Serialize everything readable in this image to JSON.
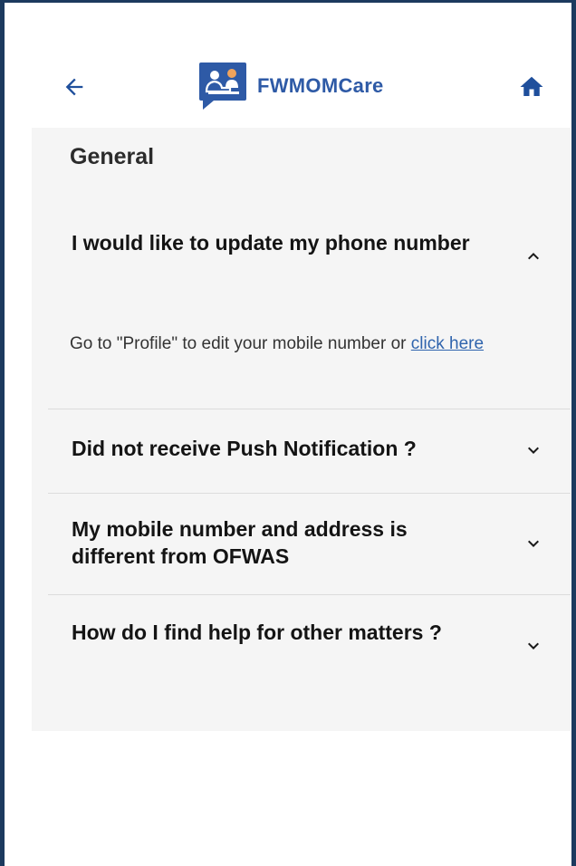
{
  "header": {
    "app_name": "FWMOMCare",
    "icons": {
      "back": "arrow-left-icon",
      "home": "home-icon"
    },
    "colors": {
      "brand": "#2e5aa6",
      "frame": "#1c3a5e"
    }
  },
  "section": {
    "title": "General"
  },
  "faqs": [
    {
      "question": "I would like to update my phone number",
      "expanded": true,
      "answer_text": "Go to \"Profile\" to edit your mobile number or ",
      "answer_link": "click here"
    },
    {
      "question": "Did not receive Push Notification ?",
      "expanded": false
    },
    {
      "question": "My mobile number and address is different from OFWAS",
      "expanded": false
    },
    {
      "question": "How do I find help for other matters ?",
      "expanded": false
    }
  ]
}
